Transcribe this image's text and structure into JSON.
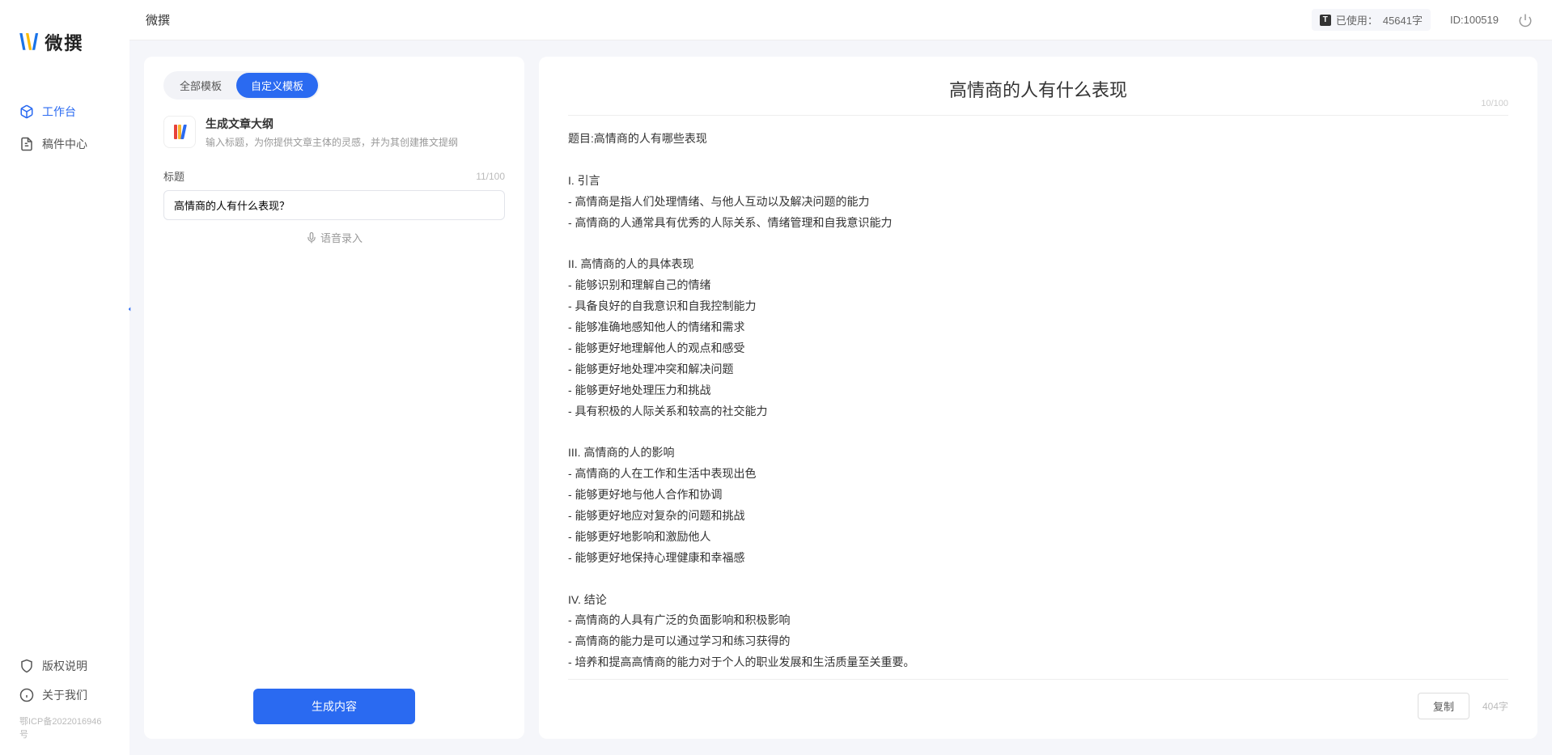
{
  "header": {
    "title": "微撰",
    "usage_label": "已使用：",
    "usage_value": "45641字",
    "id_label": "ID:100519"
  },
  "sidebar": {
    "logo_text": "微撰",
    "nav": [
      {
        "label": "工作台"
      },
      {
        "label": "稿件中心"
      }
    ],
    "footer": [
      {
        "label": "版权说明"
      },
      {
        "label": "关于我们"
      }
    ],
    "icp": "鄂ICP备2022016946号"
  },
  "left": {
    "tabs": [
      "全部模板",
      "自定义模板"
    ],
    "template": {
      "title": "生成文章大纲",
      "desc": "输入标题，为你提供文章主体的灵感，并为其创建推文提纲"
    },
    "form": {
      "label": "标题",
      "count": "11/100",
      "value": "高情商的人有什么表现？"
    },
    "voice": "语音录入",
    "generate": "生成内容"
  },
  "right": {
    "title": "高情商的人有什么表现",
    "title_count": "10/100",
    "body": "题目:高情商的人有哪些表现\n\nI. 引言\n- 高情商是指人们处理情绪、与他人互动以及解决问题的能力\n- 高情商的人通常具有优秀的人际关系、情绪管理和自我意识能力\n\nII. 高情商的人的具体表现\n- 能够识别和理解自己的情绪\n- 具备良好的自我意识和自我控制能力\n- 能够准确地感知他人的情绪和需求\n- 能够更好地理解他人的观点和感受\n- 能够更好地处理冲突和解决问题\n- 能够更好地处理压力和挑战\n- 具有积极的人际关系和较高的社交能力\n\nIII. 高情商的人的影响\n- 高情商的人在工作和生活中表现出色\n- 能够更好地与他人合作和协调\n- 能够更好地应对复杂的问题和挑战\n- 能够更好地影响和激励他人\n- 能够更好地保持心理健康和幸福感\n\nIV. 结论\n- 高情商的人具有广泛的负面影响和积极影响\n- 高情商的能力是可以通过学习和练习获得的\n- 培养和提高高情商的能力对于个人的职业发展和生活质量至关重要。",
    "copy": "复制",
    "word_count": "404字"
  }
}
